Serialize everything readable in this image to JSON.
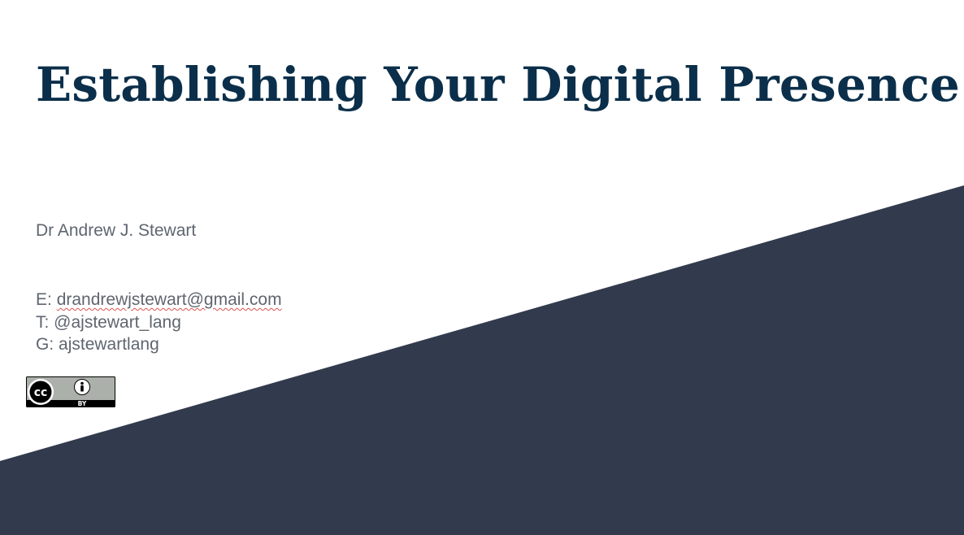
{
  "slide": {
    "title": "Establishing Your Digital Presence",
    "author": "Dr Andrew J. Stewart",
    "contacts": [
      {
        "prefix": "E: ",
        "value": "drandrewjstewart@gmail.com"
      },
      {
        "prefix": "T: ",
        "value": "@ajstewart_lang"
      },
      {
        "prefix": "G: ",
        "value": "ajstewartlang"
      }
    ],
    "license_badge": {
      "icon": "cc-by-icon",
      "text": "BY"
    }
  },
  "colors": {
    "title": "#0b2f4a",
    "body_text": "#5f6670",
    "dark_band": "#323a4d",
    "background": "#ffffff"
  }
}
